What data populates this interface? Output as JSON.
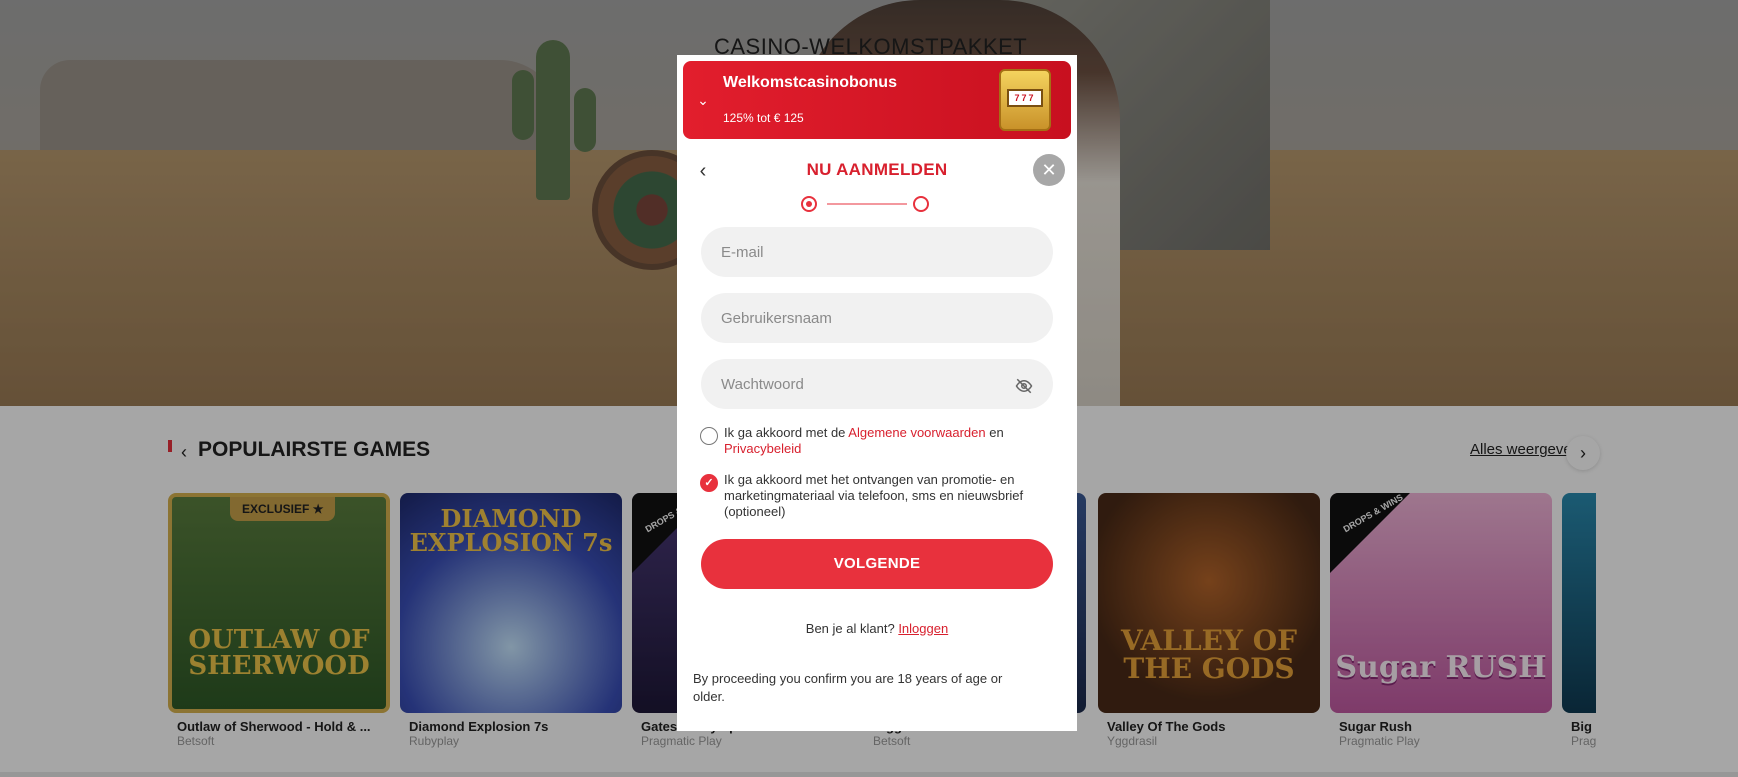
{
  "hero": {
    "title": "CASINO-WELKOMSTPAKKET"
  },
  "section": {
    "title": "POPULAIRSTE GAMES",
    "see_all": "Alles weergeven"
  },
  "games": [
    {
      "name": "Outlaw of Sherwood - Hold & ...",
      "provider": "Betsoft",
      "badge": "EXCLUSIEF",
      "art": "OUTLAW OF SHERWOOD",
      "color": "#2f6b34"
    },
    {
      "name": "Diamond Explosion 7s",
      "provider": "Rubyplay",
      "art": "DIAMOND EXPLOSION 7s",
      "color": "#3a4fb8"
    },
    {
      "name": "Gates of Olympus",
      "provider": "Pragmatic Play",
      "art": "",
      "color": "#3b2c63",
      "tag": "DROPS & WINS"
    },
    {
      "name": "Bigger Bass",
      "provider": "Betsoft",
      "art": "",
      "color": "#2a3d6d"
    },
    {
      "name": "Valley Of The Gods",
      "provider": "Yggdrasil",
      "art": "VALLEY OF THE GODS",
      "color": "#4a2a17"
    },
    {
      "name": "Sugar Rush",
      "provider": "Pragmatic Play",
      "art": "Sugar RUSH",
      "color": "#d67bb9",
      "tag": "DROPS & WINS"
    },
    {
      "name": "Big",
      "provider": "Prag",
      "art": "",
      "color": "#1b5d78"
    }
  ],
  "modal": {
    "bonus_title": "Welkomstcasinobonus",
    "bonus_subtitle": "125% tot € 125",
    "title": "NU AANMELDEN",
    "email_placeholder": "E-mail",
    "username_placeholder": "Gebruikersnaam",
    "password_placeholder": "Wachtwoord",
    "terms_prefix": "Ik ga akkoord met de ",
    "terms_link": "Algemene voorwaarden",
    "terms_middle": " en ",
    "privacy_link": "Privacybeleid",
    "marketing_text": "Ik ga akkoord met het ontvangen van promotie- en marketingmateriaal via telefoon, sms en nieuwsbrief (optioneel)",
    "next_button": "VOLGENDE",
    "login_prompt": "Ben je al klant?",
    "login_link": "Inloggen",
    "legal_text": "By proceeding you confirm you are 18 years of age or older.",
    "terms_checked": false,
    "marketing_checked": true,
    "current_step": 1,
    "total_steps": 2
  },
  "colors": {
    "brand_red": "#e8313d",
    "title_red": "#d8202e"
  },
  "icons": [
    "chevron-down-icon",
    "back-arrow-icon",
    "close-icon",
    "eye-off-icon",
    "checkmark-icon",
    "chevron-left-icon",
    "chevron-right-icon",
    "star-icon"
  ]
}
